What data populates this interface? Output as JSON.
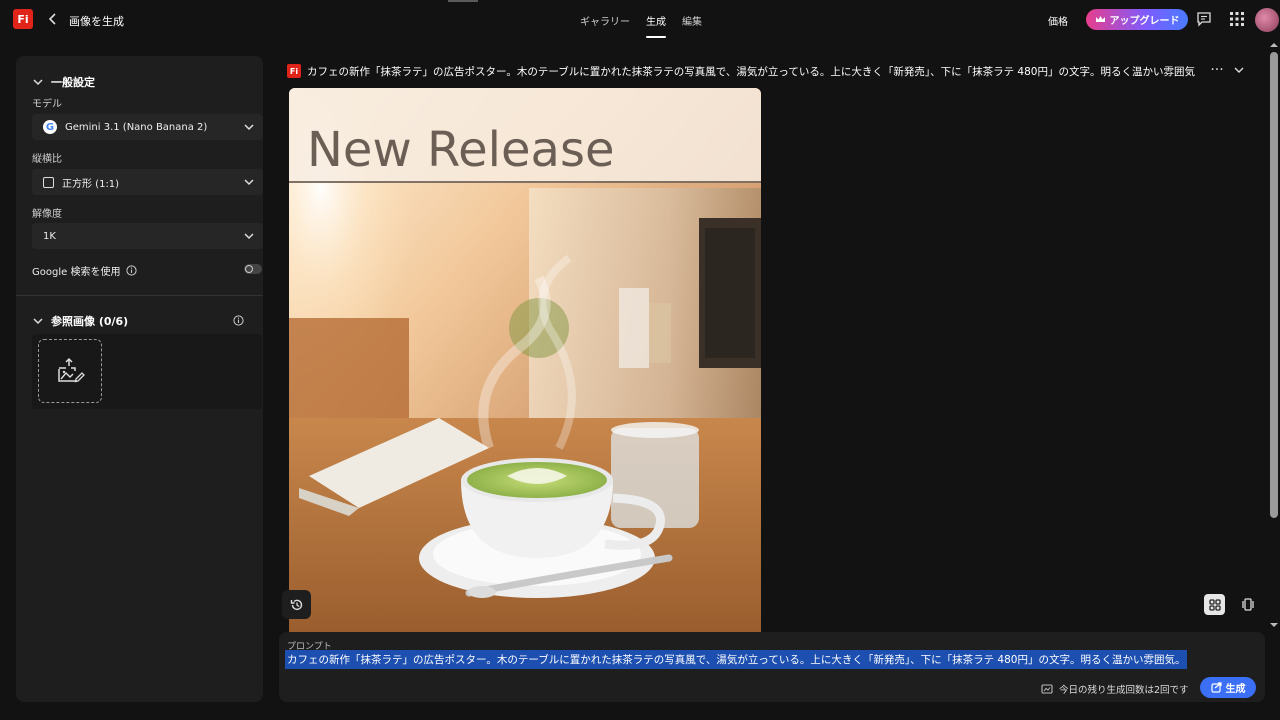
{
  "header": {
    "logo_text": "Fi",
    "title": "画像を生成",
    "tabs": [
      {
        "label": "ギャラリー",
        "active": false
      },
      {
        "label": "生成",
        "active": true
      },
      {
        "label": "編集",
        "active": false
      }
    ],
    "price_label": "価格",
    "upgrade_label": "アップグレード"
  },
  "sidebar": {
    "general_title": "一般設定",
    "model_label": "モデル",
    "model_value": "Gemini 3.1 (Nano Banana 2)",
    "model_icon_letter": "G",
    "aspect_label": "縦横比",
    "aspect_value": "正方形 (1:1)",
    "resolution_label": "解像度",
    "resolution_value": "1K",
    "google_search_label": "Google 検索を使用",
    "google_search_on": false,
    "reference_title": "参照画像 (0/6)"
  },
  "main": {
    "prompt_header": "カフェの新作「抹茶ラテ」の広告ポスター。木のテーブルに置かれた抹茶ラテの写真風で、湯気が立っている。上に大きく「新発売」、下に「抹茶ラテ 480円」の文字。明るく温かい雰囲気",
    "image_text": "New Release"
  },
  "composer": {
    "label": "プロンプト",
    "text": "カフェの新作「抹茶ラテ」の広告ポスター。木のテーブルに置かれた抹茶ラテの写真風で、湯気が立っている。上に大きく「新発売」、下に「抹茶ラテ 480円」の文字。明るく温かい雰囲気。",
    "remaining": "今日の残り生成回数は2回です",
    "generate_label": "生成"
  },
  "colors": {
    "accent": "#3b6ff5",
    "brand": "#e0241a"
  }
}
